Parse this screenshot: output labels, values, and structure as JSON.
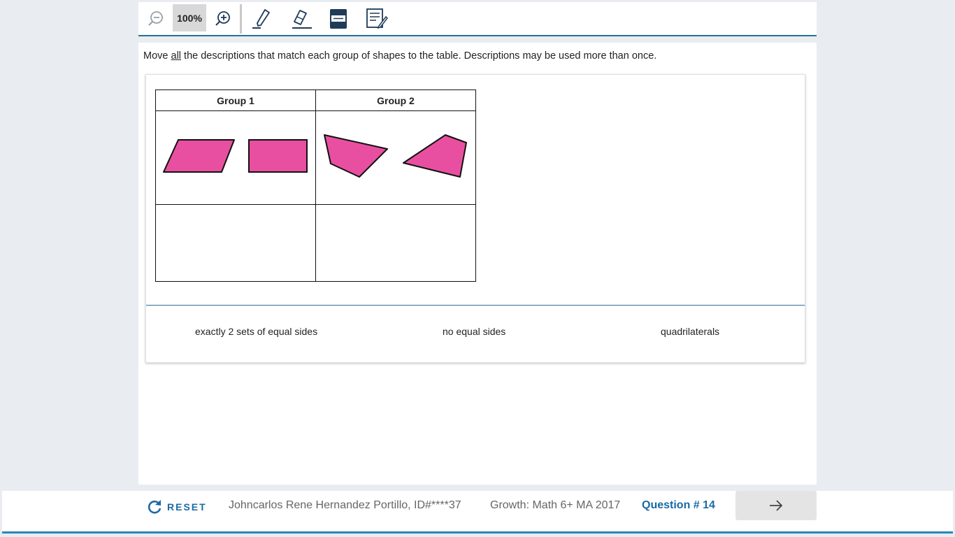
{
  "toolbar": {
    "zoom_level": "100%",
    "icons": [
      "zoom-out-icon",
      "zoom-in-icon",
      "highlighter-icon",
      "eraser-icon",
      "line-reader-icon",
      "notepad-icon"
    ]
  },
  "question": {
    "prompt_before": "Move ",
    "prompt_emphasis": "all",
    "prompt_after": " the descriptions that match each group of shapes to the table. Descriptions may be used more than once.",
    "table": {
      "headers": [
        "Group 1",
        "Group 2"
      ]
    },
    "options": [
      "exactly 2 sets of equal sides",
      "no equal sides",
      "quadrilaterals"
    ],
    "shape_color": "#e94fa0"
  },
  "footer": {
    "reset_label": "RESET",
    "student": "Johncarlos Rene Hernandez Portillo, ID#****37",
    "test_name": "Growth: Math 6+ MA 2017",
    "question_number": "Question # 14"
  },
  "colors": {
    "accent": "#2a6f97",
    "link": "#1b6aa5",
    "background": "#e9ecf0"
  }
}
